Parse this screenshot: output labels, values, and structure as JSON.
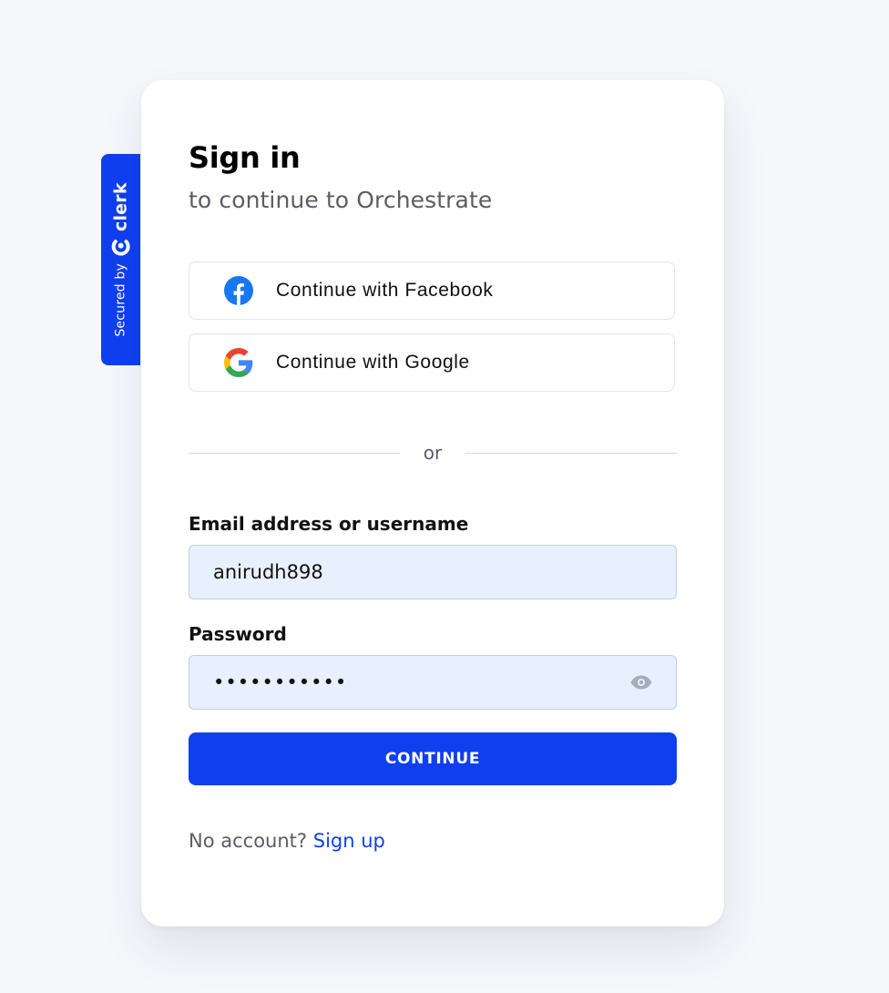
{
  "badge": {
    "secured_by": "Secured by",
    "brand": "clerk"
  },
  "signin": {
    "title": "Sign in",
    "subtitle": "to continue to Orchestrate",
    "social": {
      "facebook_label": "Continue with Facebook",
      "google_label": "Continue with Google"
    },
    "divider": "or",
    "email": {
      "label": "Email address or username",
      "value": "anirudh898"
    },
    "password": {
      "label": "Password",
      "value": "•••••••••••"
    },
    "continue_label": "CONTINUE",
    "footer": {
      "prompt": "No account?",
      "link": "Sign up"
    }
  },
  "colors": {
    "brand_blue": "#103ff0",
    "input_background": "#e8f0fe",
    "page_background": "#f6f7fb"
  },
  "icons": {
    "clerk": "clerk-logo-icon",
    "facebook": "facebook-icon",
    "google": "google-icon",
    "password_visibility": "eye-icon"
  }
}
